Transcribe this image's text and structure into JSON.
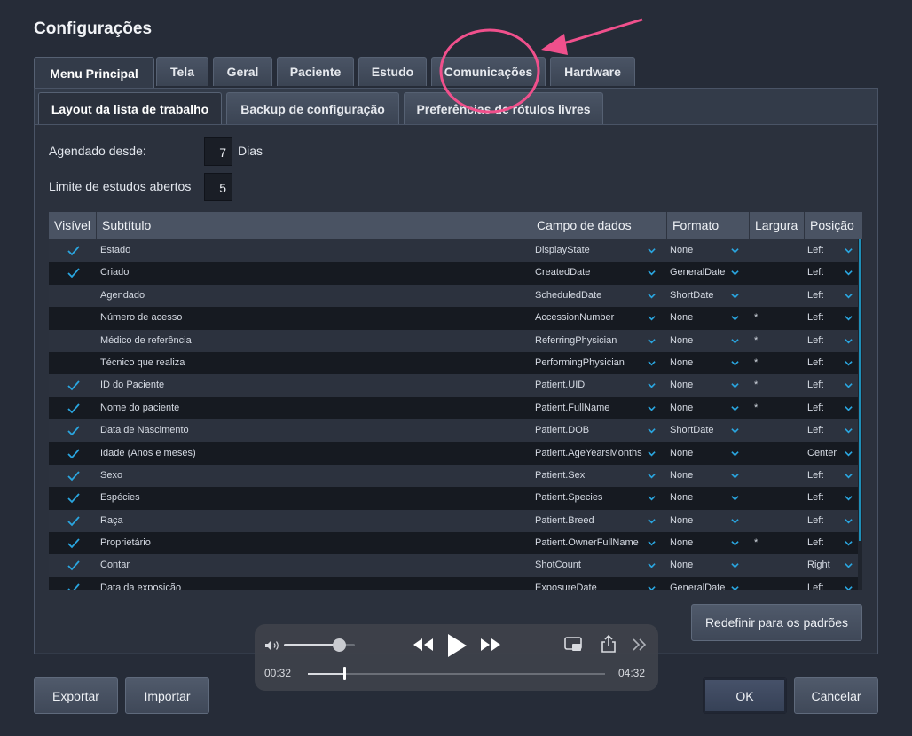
{
  "window": {
    "title": "Configurações"
  },
  "tabs": [
    "Menu Principal",
    "Tela",
    "Geral",
    "Paciente",
    "Estudo",
    "Comunicações",
    "Hardware"
  ],
  "subtabs": [
    "Layout da lista de trabalho",
    "Backup de configuração",
    "Preferências de rótulos livres"
  ],
  "settings": {
    "scheduled_label": "Agendado desde:",
    "scheduled_value": "7",
    "scheduled_unit": "Dias",
    "open_limit_label": "Limite de estudos abertos",
    "open_limit_value": "5"
  },
  "table": {
    "headers": [
      "Visível",
      "Subtítulo",
      "Campo de dados",
      "Formato",
      "Largura",
      "Posição"
    ],
    "rows": [
      {
        "visible": true,
        "subtitle": "Estado",
        "field": "DisplayState",
        "format": "None",
        "width": "",
        "position": "Left"
      },
      {
        "visible": true,
        "subtitle": "Criado",
        "field": "CreatedDate",
        "format": "GeneralDate",
        "width": "",
        "position": "Left"
      },
      {
        "visible": false,
        "subtitle": "Agendado",
        "field": "ScheduledDate",
        "format": "ShortDate",
        "width": "",
        "position": "Left"
      },
      {
        "visible": false,
        "subtitle": "Número de acesso",
        "field": "AccessionNumber",
        "format": "None",
        "width": "*",
        "position": "Left"
      },
      {
        "visible": false,
        "subtitle": "Médico de referência",
        "field": "ReferringPhysician",
        "format": "None",
        "width": "*",
        "position": "Left"
      },
      {
        "visible": false,
        "subtitle": "Técnico que realiza",
        "field": "PerformingPhysician",
        "format": "None",
        "width": "*",
        "position": "Left"
      },
      {
        "visible": true,
        "subtitle": "ID do Paciente",
        "field": "Patient.UID",
        "format": "None",
        "width": "*",
        "position": "Left"
      },
      {
        "visible": true,
        "subtitle": "Nome do paciente",
        "field": "Patient.FullName",
        "format": "None",
        "width": "*",
        "position": "Left"
      },
      {
        "visible": true,
        "subtitle": "Data de Nascimento",
        "field": "Patient.DOB",
        "format": "ShortDate",
        "width": "",
        "position": "Left"
      },
      {
        "visible": true,
        "subtitle": "Idade (Anos e meses)",
        "field": "Patient.AgeYearsMonths",
        "format": "None",
        "width": "",
        "position": "Center"
      },
      {
        "visible": true,
        "subtitle": "Sexo",
        "field": "Patient.Sex",
        "format": "None",
        "width": "",
        "position": "Left"
      },
      {
        "visible": true,
        "subtitle": "Espécies",
        "field": "Patient.Species",
        "format": "None",
        "width": "",
        "position": "Left"
      },
      {
        "visible": true,
        "subtitle": "Raça",
        "field": "Patient.Breed",
        "format": "None",
        "width": "",
        "position": "Left"
      },
      {
        "visible": true,
        "subtitle": "Proprietário",
        "field": "Patient.OwnerFullName",
        "format": "None",
        "width": "*",
        "position": "Left"
      },
      {
        "visible": true,
        "subtitle": "Contar",
        "field": "ShotCount",
        "format": "None",
        "width": "",
        "position": "Right"
      },
      {
        "visible": true,
        "subtitle": "Data da exposição",
        "field": "ExposureDate",
        "format": "GeneralDate",
        "width": "",
        "position": "Left"
      }
    ]
  },
  "buttons": {
    "reset": "Redefinir para os padrões",
    "export": "Exportar",
    "import": "Importar",
    "ok": "OK",
    "cancel": "Cancelar"
  },
  "player": {
    "current_time": "00:32",
    "total_time": "04:32",
    "progress": 0.12,
    "volume": 0.78
  },
  "annotation": {
    "color": "#f0508c"
  },
  "icons": [
    "check-icon",
    "chevron-down-icon",
    "volume-icon",
    "rewind-icon",
    "play-icon",
    "fast-forward-icon",
    "picture-in-picture-icon",
    "share-icon",
    "more-icon"
  ]
}
